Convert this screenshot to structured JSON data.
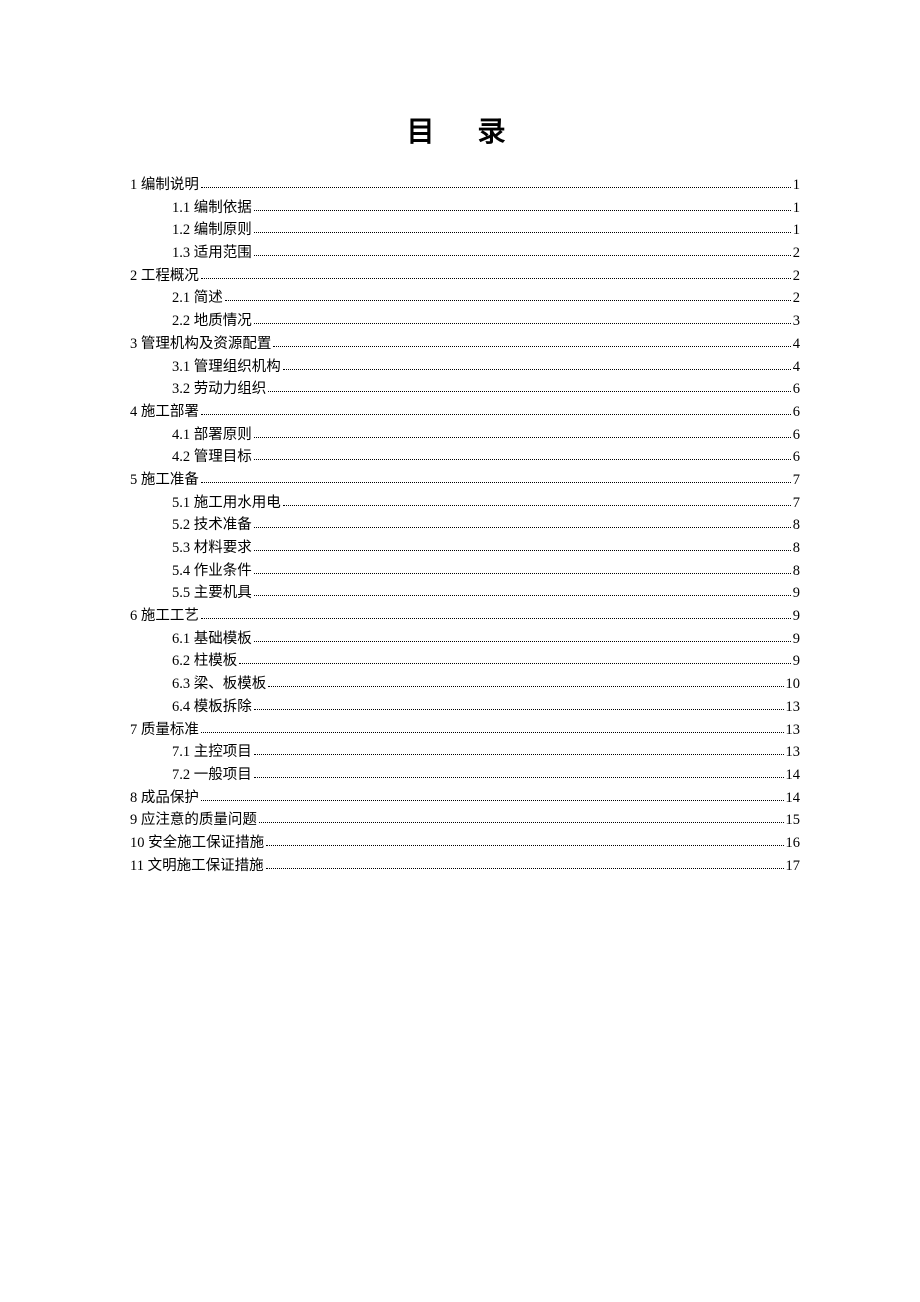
{
  "title": "目 录",
  "toc": [
    {
      "level": 1,
      "label": "1 编制说明",
      "page": "1"
    },
    {
      "level": 2,
      "label": "1.1 编制依据",
      "page": "1"
    },
    {
      "level": 2,
      "label": "1.2 编制原则",
      "page": "1"
    },
    {
      "level": 2,
      "label": "1.3 适用范围",
      "page": "2"
    },
    {
      "level": 1,
      "label": "2 工程概况",
      "page": "2"
    },
    {
      "level": 2,
      "label": "2.1 简述",
      "page": "2"
    },
    {
      "level": 2,
      "label": "2.2 地质情况",
      "page": "3"
    },
    {
      "level": 1,
      "label": "3 管理机构及资源配置",
      "page": "4"
    },
    {
      "level": 2,
      "label": "3.1 管理组织机构",
      "page": "4"
    },
    {
      "level": 2,
      "label": "3.2 劳动力组织",
      "page": "6"
    },
    {
      "level": 1,
      "label": "4 施工部署",
      "page": "6"
    },
    {
      "level": 2,
      "label": "4.1 部署原则",
      "page": "6"
    },
    {
      "level": 2,
      "label": "4.2 管理目标",
      "page": "6"
    },
    {
      "level": 1,
      "label": "5 施工准备",
      "page": "7"
    },
    {
      "level": 2,
      "label": "5.1 施工用水用电",
      "page": "7"
    },
    {
      "level": 2,
      "label": "5.2 技术准备",
      "page": "8"
    },
    {
      "level": 2,
      "label": "5.3 材料要求",
      "page": "8"
    },
    {
      "level": 2,
      "label": "5.4 作业条件",
      "page": "8"
    },
    {
      "level": 2,
      "label": "5.5 主要机具",
      "page": "9"
    },
    {
      "level": 1,
      "label": "6 施工工艺",
      "page": "9"
    },
    {
      "level": 2,
      "label": "6.1 基础模板",
      "page": "9"
    },
    {
      "level": 2,
      "label": "6.2 柱模板",
      "page": "9"
    },
    {
      "level": 2,
      "label": "6.3 梁、板模板",
      "page": "10"
    },
    {
      "level": 2,
      "label": "6.4 模板拆除",
      "page": "13"
    },
    {
      "level": 1,
      "label": "7 质量标准",
      "page": "13"
    },
    {
      "level": 2,
      "label": "7.1 主控项目",
      "page": "13"
    },
    {
      "level": 2,
      "label": "7.2 一般项目",
      "page": "14"
    },
    {
      "level": 1,
      "label": "8 成品保护",
      "page": "14"
    },
    {
      "level": 1,
      "label": "9 应注意的质量问题",
      "page": "15"
    },
    {
      "level": 1,
      "label": "10 安全施工保证措施",
      "page": "16"
    },
    {
      "level": 1,
      "label": "11 文明施工保证措施",
      "page": "17"
    }
  ]
}
